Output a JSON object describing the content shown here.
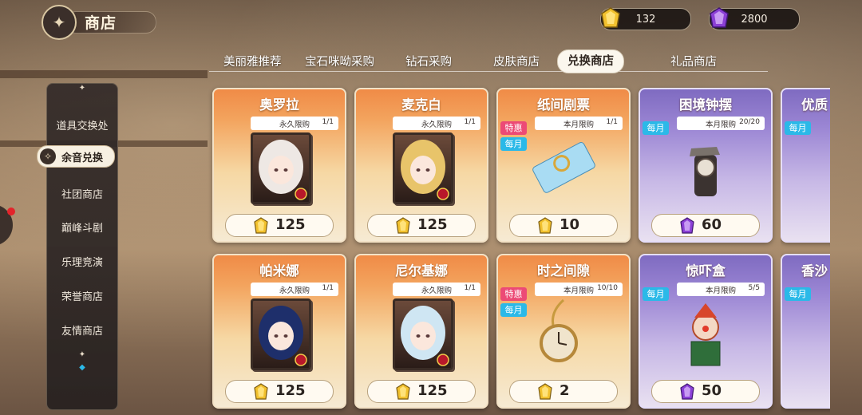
{
  "header": {
    "title": "商店"
  },
  "currencies": [
    {
      "icon": "gold-crystal-icon",
      "value": "132"
    },
    {
      "icon": "purple-crystal-icon",
      "value": "2800"
    }
  ],
  "tabs": [
    "美丽雅推荐",
    "宝石咪呦采购",
    "钻石采购",
    "皮肤商店",
    "兑换商店",
    "礼品商店"
  ],
  "active_tab": "兑换商店",
  "sidebar": {
    "items": [
      "道具交换处",
      "余音兑换",
      "社团商店",
      "巅峰斗剧",
      "乐理竞演",
      "荣誉商店",
      "友情商店"
    ],
    "active": "余音兑换"
  },
  "cards": [
    {
      "name": "奥罗拉",
      "limit": "永久限购",
      "count": "1/1",
      "price": "125",
      "currency": "gold",
      "theme": "orange",
      "badges": []
    },
    {
      "name": "麦克白",
      "limit": "永久限购",
      "count": "1/1",
      "price": "125",
      "currency": "gold",
      "theme": "orange",
      "badges": []
    },
    {
      "name": "纸间剧票",
      "limit": "本月限购",
      "count": "1/1",
      "price": "10",
      "currency": "gold",
      "theme": "orange",
      "badges": [
        "特惠",
        "每月"
      ]
    },
    {
      "name": "困境钟摆",
      "limit": "本月限购",
      "count": "20/20",
      "price": "60",
      "currency": "purple",
      "theme": "purple",
      "badges": [
        "每月"
      ]
    },
    {
      "name": "帕米娜",
      "limit": "永久限购",
      "count": "1/1",
      "price": "125",
      "currency": "gold",
      "theme": "orange",
      "badges": []
    },
    {
      "name": "尼尔基娜",
      "limit": "永久限购",
      "count": "1/1",
      "price": "125",
      "currency": "gold",
      "theme": "orange",
      "badges": []
    },
    {
      "name": "时之间隙",
      "limit": "本月限购",
      "count": "10/10",
      "price": "2",
      "currency": "gold",
      "theme": "orange",
      "badges": [
        "特惠",
        "每月"
      ]
    },
    {
      "name": "惊吓盒",
      "limit": "本月限购",
      "count": "5/5",
      "price": "50",
      "currency": "purple",
      "theme": "purple",
      "badges": [
        "每月"
      ]
    }
  ],
  "partial_cards": [
    {
      "name": "优质",
      "badge": "每月"
    },
    {
      "name": "香沙",
      "badge": "每月"
    }
  ],
  "colors": {
    "gold": "#f2c12e",
    "purple": "#8b3fd6",
    "sale": "#ec4a76",
    "month": "#2bb9e8"
  }
}
